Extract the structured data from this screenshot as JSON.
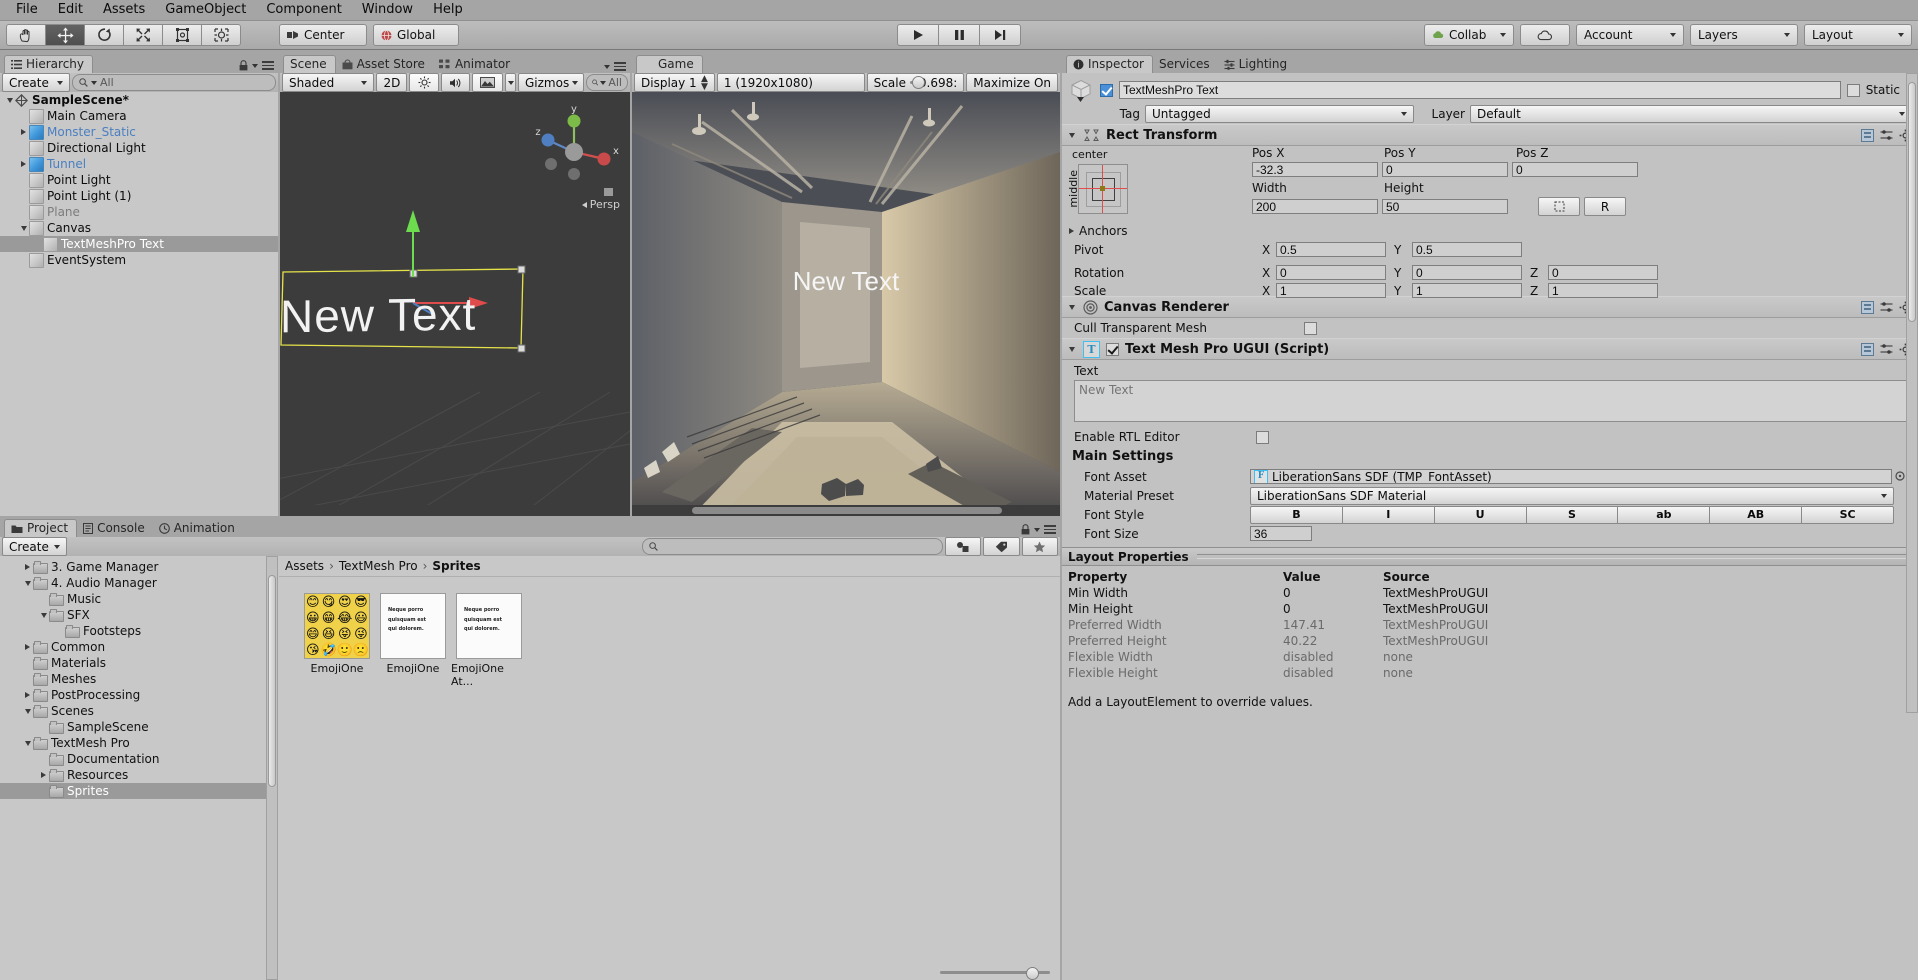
{
  "menubar": [
    "File",
    "Edit",
    "Assets",
    "GameObject",
    "Component",
    "Window",
    "Help"
  ],
  "toolbar": {
    "tools": [
      "hand-tool",
      "move-tool",
      "rotate-tool",
      "scale-tool",
      "rect-tool",
      "transform-tool"
    ],
    "pivot_mode": "Center",
    "pivot_rotation": "Global",
    "play": "play-icon",
    "pause": "pause-icon",
    "step": "step-icon",
    "collab": "Collab",
    "cloud": "cloud-icon",
    "account": "Account",
    "layers": "Layers",
    "layout": "Layout"
  },
  "hierarchy": {
    "tab": "Hierarchy",
    "create": "Create",
    "search_placeholder": "All",
    "items": [
      {
        "label": "SampleScene*",
        "depth": 0,
        "arrow": "down",
        "icon": "scene-icon",
        "bold": true
      },
      {
        "label": "Main Camera",
        "depth": 1,
        "arrow": "none",
        "icon": "gameobject-icon"
      },
      {
        "label": "Monster_Static",
        "depth": 1,
        "arrow": "right",
        "icon": "prefab-icon",
        "prefab": true
      },
      {
        "label": "Directional Light",
        "depth": 1,
        "arrow": "none",
        "icon": "gameobject-icon"
      },
      {
        "label": "Tunnel",
        "depth": 1,
        "arrow": "right",
        "icon": "prefab-icon",
        "prefab": true
      },
      {
        "label": "Point Light",
        "depth": 1,
        "arrow": "none",
        "icon": "gameobject-icon"
      },
      {
        "label": "Point Light (1)",
        "depth": 1,
        "arrow": "none",
        "icon": "gameobject-icon"
      },
      {
        "label": "Plane",
        "depth": 1,
        "arrow": "none",
        "icon": "gameobject-icon",
        "disabled": true
      },
      {
        "label": "Canvas",
        "depth": 1,
        "arrow": "down",
        "icon": "gameobject-icon"
      },
      {
        "label": "TextMeshPro Text",
        "depth": 2,
        "arrow": "none",
        "icon": "gameobject-icon",
        "selected": true
      },
      {
        "label": "EventSystem",
        "depth": 1,
        "arrow": "none",
        "icon": "gameobject-icon"
      }
    ]
  },
  "scene_panel": {
    "tabs": [
      {
        "label": "Scene",
        "icon": "scene-tab-icon",
        "active": true
      },
      {
        "label": "Asset Store",
        "icon": "store-icon",
        "active": false
      },
      {
        "label": "Animator",
        "icon": "animator-icon",
        "active": false
      }
    ],
    "draw_mode": "Shaded",
    "mode_2d": "2D",
    "lighting": "sun-icon",
    "audio": "speaker-icon",
    "fx": "fx-icon",
    "gizmos": "Gizmos",
    "search_placeholder": "All",
    "persp_label": "Persp",
    "axis_labels": [
      "y",
      "z",
      "x"
    ],
    "scene_text": "New Text"
  },
  "game_panel": {
    "tab": "Game",
    "display": "Display 1",
    "resolution": "1 (1920x1080)",
    "scale_label": "Scale",
    "scale_value": "0.698:",
    "maximize": "Maximize On",
    "game_text": "New Text"
  },
  "inspector": {
    "tabs": [
      {
        "label": "Inspector",
        "icon": "inspector-icon",
        "active": true
      },
      {
        "label": "Services",
        "icon": "services-icon",
        "active": false
      },
      {
        "label": "Lighting",
        "icon": "lighting-icon",
        "active": false
      }
    ],
    "object_name": "TextMeshPro Text",
    "enabled": true,
    "static_label": "Static",
    "tag_label": "Tag",
    "tag_value": "Untagged",
    "layer_label": "Layer",
    "layer_value": "Default",
    "rect_transform": {
      "title": "Rect Transform",
      "anchor_h": "center",
      "anchor_v": "middle",
      "pos_x_label": "Pos X",
      "pos_x": "-32.3",
      "pos_y_label": "Pos Y",
      "pos_y": "0",
      "pos_z_label": "Pos Z",
      "pos_z": "0",
      "width_label": "Width",
      "width": "200",
      "height_label": "Height",
      "height": "50",
      "blueprint_label": "R",
      "anchors_label": "Anchors",
      "pivot_label": "Pivot",
      "pivot_x": "0.5",
      "pivot_y": "0.5",
      "rotation_label": "Rotation",
      "rot_x": "0",
      "rot_y": "0",
      "rot_z": "0",
      "scale_label": "Scale",
      "scale_x": "1",
      "scale_y": "1",
      "scale_z": "1"
    },
    "canvas_renderer": {
      "title": "Canvas Renderer",
      "cull_label": "Cull Transparent Mesh",
      "cull_checked": false
    },
    "tmp": {
      "title": "Text Mesh Pro UGUI (Script)",
      "enabled": true,
      "text_label": "Text",
      "text_value": "New Text",
      "rtl_label": "Enable RTL Editor",
      "rtl_checked": false,
      "main_settings": "Main Settings",
      "font_asset_label": "Font Asset",
      "font_asset_value": "LiberationSans SDF (TMP_FontAsset)",
      "material_preset_label": "Material Preset",
      "material_preset_value": "LiberationSans SDF Material",
      "font_style_label": "Font Style",
      "font_style_buttons": [
        "B",
        "I",
        "U",
        "S",
        "ab",
        "AB",
        "SC"
      ],
      "font_size_label": "Font Size",
      "font_size_value": "36"
    },
    "layout_properties": {
      "title": "Layout Properties",
      "columns": [
        "Property",
        "Value",
        "Source"
      ],
      "rows": [
        {
          "property": "Min Width",
          "value": "0",
          "source": "TextMeshProUGUI",
          "dim": false
        },
        {
          "property": "Min Height",
          "value": "0",
          "source": "TextMeshProUGUI",
          "dim": false
        },
        {
          "property": "Preferred Width",
          "value": "147.41",
          "source": "TextMeshProUGUI",
          "dim": true
        },
        {
          "property": "Preferred Height",
          "value": "40.22",
          "source": "TextMeshProUGUI",
          "dim": true
        },
        {
          "property": "Flexible Width",
          "value": "disabled",
          "source": "none",
          "dim": true
        },
        {
          "property": "Flexible Height",
          "value": "disabled",
          "source": "none",
          "dim": true
        }
      ],
      "footer": "Add a LayoutElement to override values."
    }
  },
  "project": {
    "tabs": [
      {
        "label": "Project",
        "icon": "project-icon",
        "active": true
      },
      {
        "label": "Console",
        "icon": "console-icon",
        "active": false
      },
      {
        "label": "Animation",
        "icon": "animation-icon",
        "active": false
      }
    ],
    "create": "Create",
    "search_placeholder": "",
    "tree": [
      {
        "label": "3. Game Manager",
        "depth": 1,
        "arrow": "right"
      },
      {
        "label": "4. Audio Manager",
        "depth": 1,
        "arrow": "down"
      },
      {
        "label": "Music",
        "depth": 2,
        "arrow": "none"
      },
      {
        "label": "SFX",
        "depth": 2,
        "arrow": "down"
      },
      {
        "label": "Footsteps",
        "depth": 3,
        "arrow": "none"
      },
      {
        "label": "Common",
        "depth": 1,
        "arrow": "right"
      },
      {
        "label": "Materials",
        "depth": 1,
        "arrow": "none"
      },
      {
        "label": "Meshes",
        "depth": 1,
        "arrow": "none"
      },
      {
        "label": "PostProcessing",
        "depth": 1,
        "arrow": "right"
      },
      {
        "label": "Scenes",
        "depth": 1,
        "arrow": "down"
      },
      {
        "label": "SampleScene",
        "depth": 2,
        "arrow": "none"
      },
      {
        "label": "TextMesh Pro",
        "depth": 1,
        "arrow": "down"
      },
      {
        "label": "Documentation",
        "depth": 2,
        "arrow": "none"
      },
      {
        "label": "Resources",
        "depth": 2,
        "arrow": "right"
      },
      {
        "label": "Sprites",
        "depth": 2,
        "arrow": "none",
        "selected": true
      }
    ],
    "breadcrumb": [
      "Assets",
      "TextMesh Pro",
      "Sprites"
    ],
    "assets": [
      {
        "label": "EmojiOne",
        "kind": "sprite-sheet"
      },
      {
        "label": "EmojiOne",
        "kind": "text-doc"
      },
      {
        "label": "EmojiOne At...",
        "kind": "text-doc"
      }
    ],
    "zoom_slider": 82
  },
  "colors": {
    "panel_bg": "#a5a5a5",
    "content_bg": "#c8c8c8",
    "selection": "#9a9a9a",
    "prefab_blue": "#4a7fc1",
    "accent_blue": "#4a90d9",
    "gizmo_red": "#e04b4b",
    "gizmo_green": "#5ec94f",
    "scene_bg": "#3c3c3c"
  }
}
